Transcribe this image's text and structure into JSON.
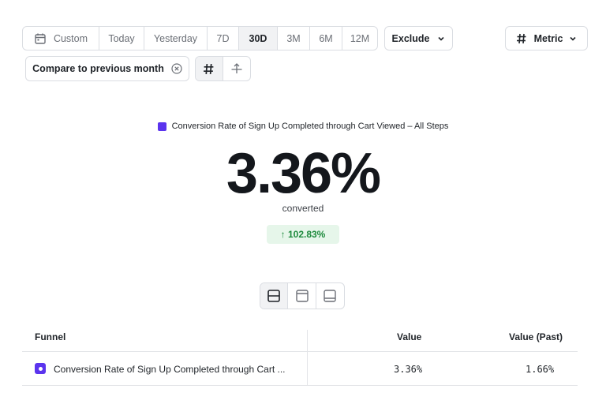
{
  "date_range": {
    "options": [
      {
        "label": "Custom",
        "icon": "calendar-icon",
        "active": false
      },
      {
        "label": "Today",
        "active": false
      },
      {
        "label": "Yesterday",
        "active": false
      },
      {
        "label": "7D",
        "active": false
      },
      {
        "label": "30D",
        "active": true
      },
      {
        "label": "3M",
        "active": false
      },
      {
        "label": "6M",
        "active": false
      },
      {
        "label": "12M",
        "active": false
      }
    ]
  },
  "exclude": {
    "label": "Exclude",
    "icon": "chevron-down-icon"
  },
  "metric": {
    "label": "Metric",
    "icon": "hash-icon"
  },
  "compare": {
    "label": "Compare to previous month",
    "clear_icon": "close-circle-icon"
  },
  "display_toggle": {
    "options": [
      "hash-icon",
      "arrow-up-icon"
    ]
  },
  "summary": {
    "legend": "Conversion Rate of Sign Up Completed through Cart Viewed – All Steps",
    "legend_color": "#5b34ee",
    "value": "3.36%",
    "sub_label": "converted",
    "change": "↑ 102.83%",
    "change_color": "#1e8a3d"
  },
  "layout_toggle": {
    "options": [
      "split-horizontal-icon",
      "panel-top-icon",
      "panel-bottom-icon"
    ],
    "active_index": 0
  },
  "table": {
    "columns": [
      "Funnel",
      "Value",
      "Value (Past)"
    ],
    "rows": [
      {
        "funnel": "Conversion Rate of Sign Up Completed through Cart ...",
        "value": "3.36%",
        "value_past": "1.66%",
        "color": "#5b34ee"
      }
    ]
  }
}
